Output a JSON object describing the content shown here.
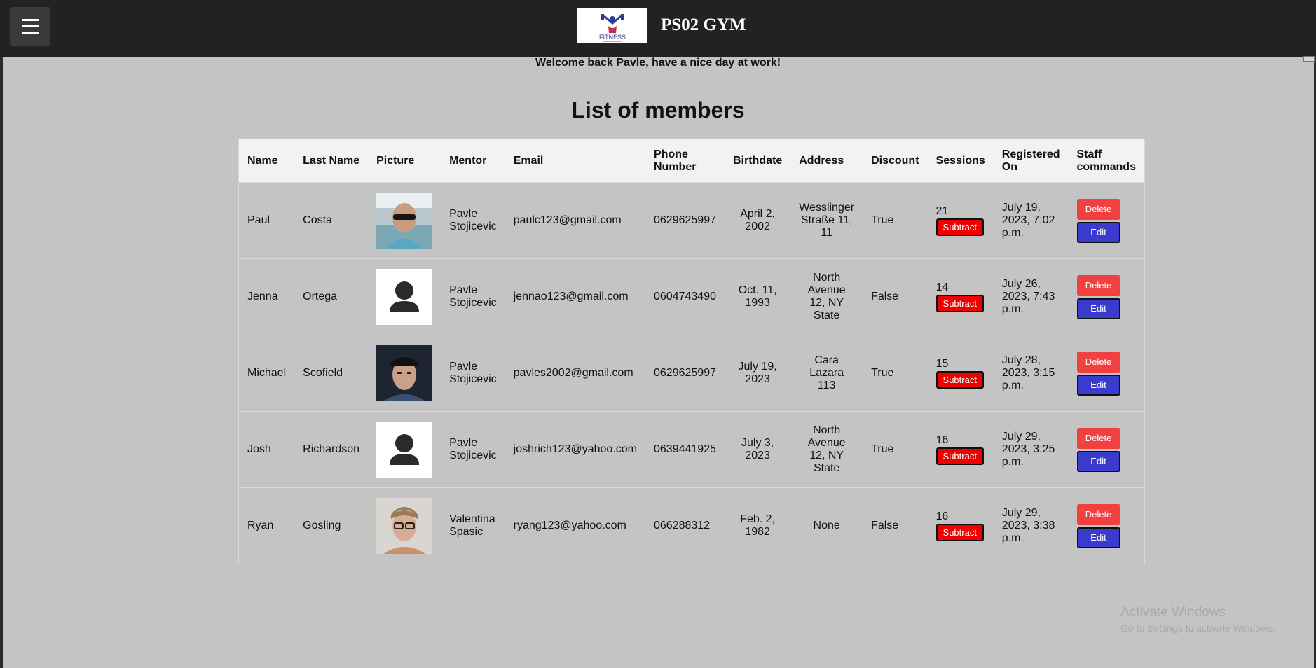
{
  "header": {
    "brand": "PS02 GYM",
    "logo_text": "FITNESS",
    "menu_icon": "hamburger-menu-icon"
  },
  "welcome": "Welcome back Pavle, have a nice day at work!",
  "title": "List of members",
  "columns": [
    "Name",
    "Last Name",
    "Picture",
    "Mentor",
    "Email",
    "Phone Number",
    "Birthdate",
    "Address",
    "Discount",
    "Sessions",
    "Registered On",
    "Staff commands"
  ],
  "buttons": {
    "subtract": "Subtract",
    "delete": "Delete",
    "edit": "Edit"
  },
  "members": [
    {
      "name": "Paul",
      "last_name": "Costa",
      "picture": "photo-man-sunglasses",
      "mentor": "Pavle Stojicevic",
      "email": "paulc123@gmail.com",
      "phone": "0629625997",
      "birthdate": "April 2, 2002",
      "address": "Wesslinger Straße 11, 11",
      "discount": "True",
      "sessions": "21",
      "registered": "July 19, 2023, 7:02 p.m."
    },
    {
      "name": "Jenna",
      "last_name": "Ortega",
      "picture": "default-avatar",
      "mentor": "Pavle Stojicevic",
      "email": "jennao123@gmail.com",
      "phone": "0604743490",
      "birthdate": "Oct. 11, 1993",
      "address": "North Avenue 12, NY State",
      "discount": "False",
      "sessions": "14",
      "registered": "July 26, 2023, 7:43 p.m."
    },
    {
      "name": "Michael",
      "last_name": "Scofield",
      "picture": "photo-man-cap",
      "mentor": "Pavle Stojicevic",
      "email": "pavles2002@gmail.com",
      "phone": "0629625997",
      "birthdate": "July 19, 2023",
      "address": "Cara Lazara 113",
      "discount": "True",
      "sessions": "15",
      "registered": "July 28, 2023, 3:15 p.m."
    },
    {
      "name": "Josh",
      "last_name": "Richardson",
      "picture": "default-avatar",
      "mentor": "Pavle Stojicevic",
      "email": "joshrich123@yahoo.com",
      "phone": "0639441925",
      "birthdate": "July 3, 2023",
      "address": "North Avenue 12, NY State",
      "discount": "True",
      "sessions": "16",
      "registered": "July 29, 2023, 3:25 p.m."
    },
    {
      "name": "Ryan",
      "last_name": "Gosling",
      "picture": "photo-man-glasses",
      "mentor": "Valentina Spasic",
      "email": "ryang123@yahoo.com",
      "phone": "066288312",
      "birthdate": "Feb. 2, 1982",
      "address": "None",
      "discount": "False",
      "sessions": "16",
      "registered": "July 29, 2023, 3:38 p.m."
    }
  ],
  "watermark": {
    "line1": "Activate Windows",
    "line2": "Go to Settings to activate Windows."
  },
  "colors": {
    "topbar": "#222222",
    "background": "#c4c4c4",
    "subtract": "#ee0000",
    "delete": "#f04040",
    "edit": "#3a3acc"
  }
}
